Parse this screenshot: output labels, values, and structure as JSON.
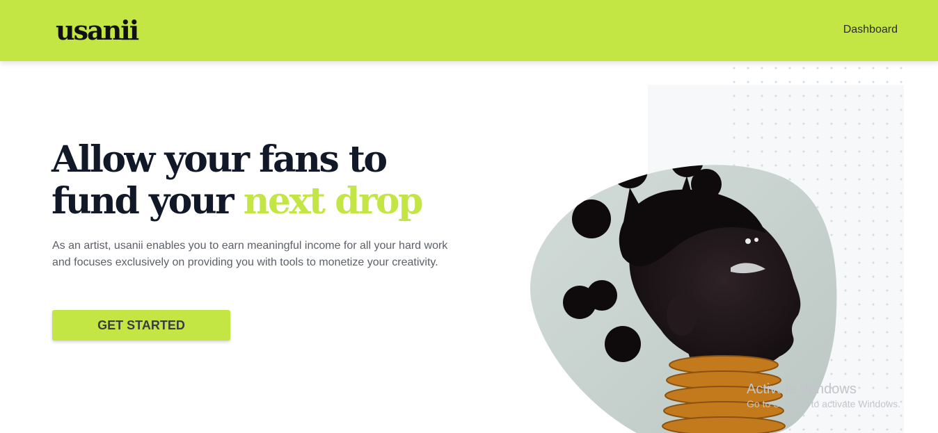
{
  "colors": {
    "accent": "#c3e644",
    "heading": "#111827",
    "body_text": "#5b6068"
  },
  "header": {
    "logo_text": "usanii",
    "nav": {
      "dashboard_label": "Dashboard"
    }
  },
  "hero": {
    "title_line1": "Allow your fans to",
    "title_line2_prefix": "fund your ",
    "title_line2_accent": "next drop",
    "description": "As an artist, usanii enables you to earn meaningful income for all your hard work and focuses exclusively on providing you with tools to monetize your creativity.",
    "cta_label": "GET STARTED",
    "image_icon": "artist-portrait-icon"
  },
  "os_watermark": {
    "title": "Activate Windows",
    "subtitle": "Go to Settings to activate Windows."
  }
}
